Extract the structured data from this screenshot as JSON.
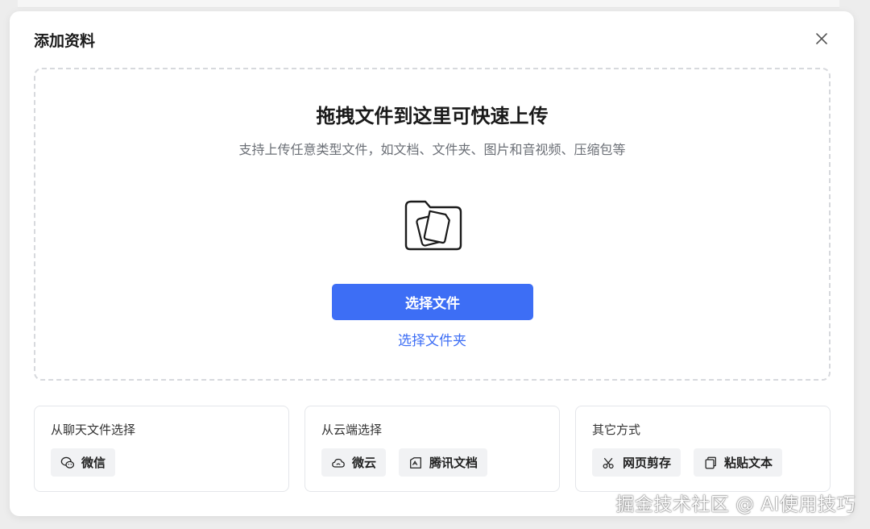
{
  "dialog": {
    "title": "添加资料",
    "close_icon": "close-icon"
  },
  "dropzone": {
    "title": "拖拽文件到这里可快速上传",
    "subtitle": "支持上传任意类型文件，如文档、文件夹、图片和音视频、压缩包等",
    "icon": "folder-files-icon",
    "primary_button": "选择文件",
    "folder_link": "选择文件夹"
  },
  "cards": [
    {
      "title": "从聊天文件选择",
      "chips": [
        {
          "label": "微信",
          "icon": "wechat-icon"
        }
      ]
    },
    {
      "title": "从云端选择",
      "chips": [
        {
          "label": "微云",
          "icon": "cloud-icon"
        },
        {
          "label": "腾讯文档",
          "icon": "tencent-docs-icon"
        }
      ]
    },
    {
      "title": "其它方式",
      "chips": [
        {
          "label": "网页剪存",
          "icon": "scissors-icon"
        },
        {
          "label": "粘贴文本",
          "icon": "paste-icon"
        }
      ]
    }
  ],
  "watermark": "掘金技术社区 @ AI使用技巧",
  "colors": {
    "accent": "#3d6ef5",
    "background": "#ededed",
    "card_border": "#e4e6ea",
    "chip_bg": "#f1f2f4"
  }
}
